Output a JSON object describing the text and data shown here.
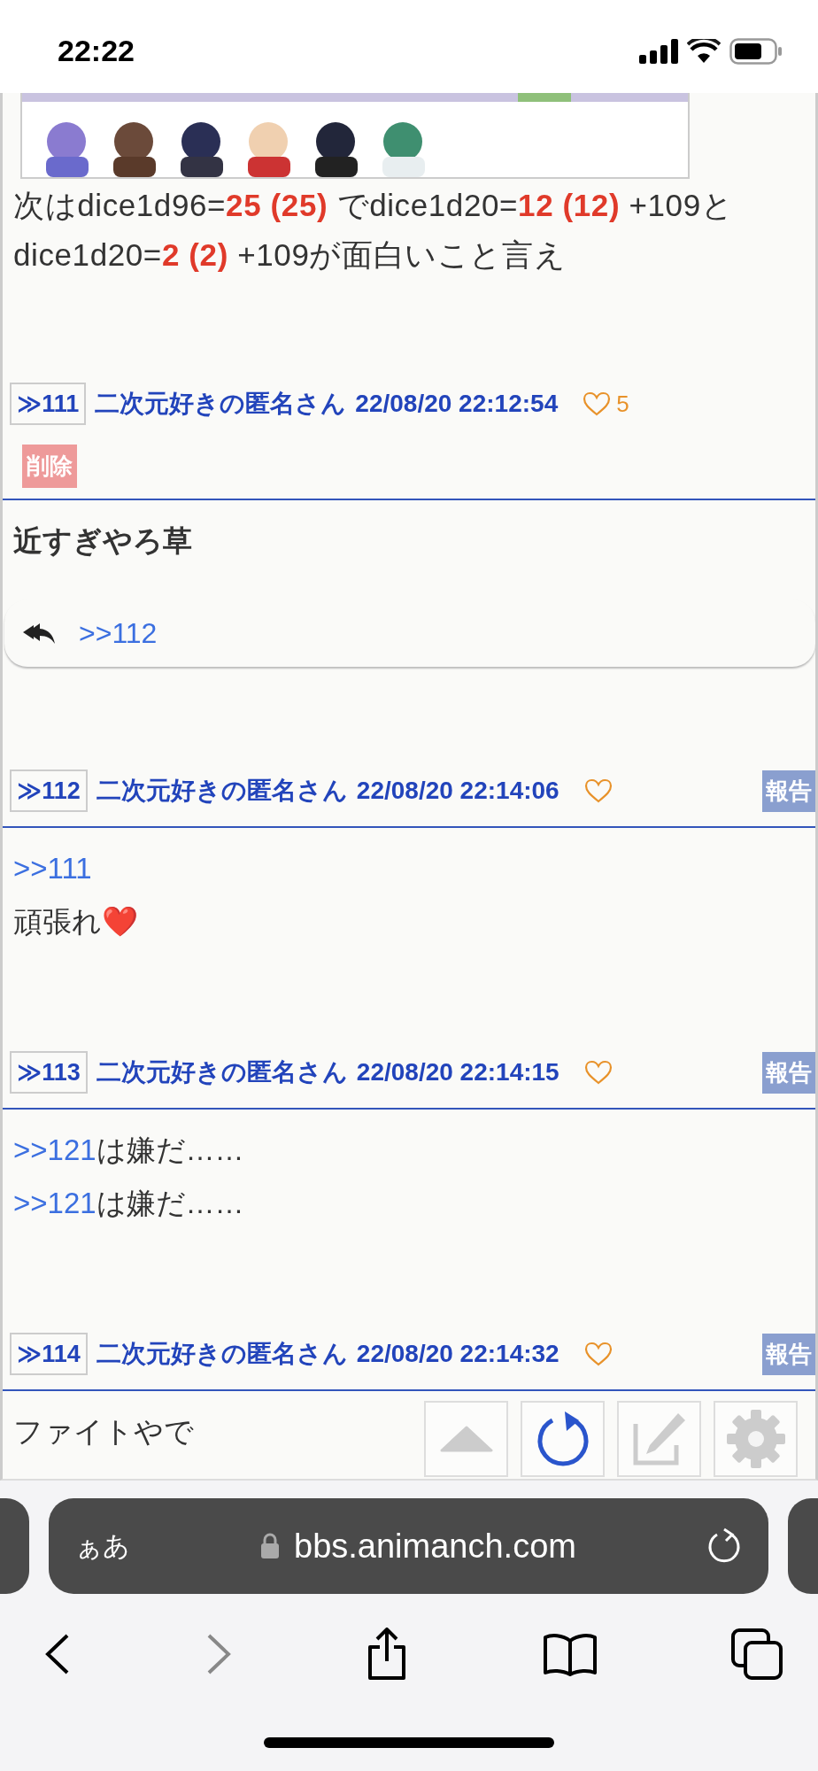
{
  "status_bar": {
    "time": "22:22"
  },
  "intro": {
    "text": "次はdice1d96=**25 (25)** でdice1d20=**12 (12)** +109とdice1d20=**2 (2)** +109が面白いこと言え"
  },
  "posts": [
    {
      "number": "≫111",
      "author": "二次元好きの匿名さん",
      "date": "22/08/20 22:12:54",
      "likes": "5",
      "action": {
        "kind": "delete",
        "label": "削除"
      },
      "bold": true,
      "lines": [
        {
          "text": "近すぎやろ草"
        }
      ],
      "replies": [
        ">>112"
      ]
    },
    {
      "number": "≫112",
      "author": "二次元好きの匿名さん",
      "date": "22/08/20 22:14:06",
      "action": {
        "kind": "report",
        "label": "報告"
      },
      "bold": false,
      "lines": [
        {
          "link": ">>111"
        },
        {
          "text": "頑張れ❤️"
        }
      ]
    },
    {
      "number": "≫113",
      "author": "二次元好きの匿名さん",
      "date": "22/08/20 22:14:15",
      "action": {
        "kind": "report",
        "label": "報告"
      },
      "bold": false,
      "lines": [
        {
          "link": ">>121",
          "text": "は嫌だ……"
        },
        {
          "link": ">>121",
          "text": "は嫌だ……"
        }
      ]
    },
    {
      "number": "≫114",
      "author": "二次元好きの匿名さん",
      "date": "22/08/20 22:14:32",
      "action": {
        "kind": "report",
        "label": "報告"
      },
      "bold": false,
      "lines": [
        {
          "text": "ファイトやで"
        }
      ]
    }
  ],
  "browser": {
    "text_size_button": "ぁあ",
    "url": "bbs.animanch.com"
  }
}
